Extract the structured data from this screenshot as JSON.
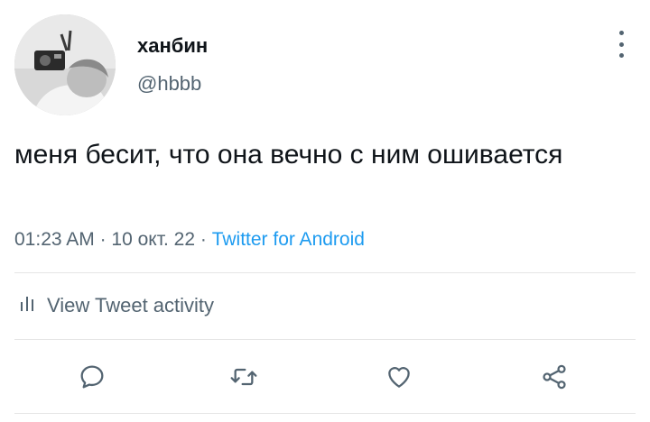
{
  "author": {
    "display_name": "ханбин",
    "handle": "@hbbb",
    "avatar_icon": "profile-photo"
  },
  "tweet": {
    "text": "меня бесит, что она вечно с ним ошивается",
    "time": "01:23 AM",
    "separator": " · ",
    "date": "10 окт. 22",
    "source": "Twitter for Android"
  },
  "activity": {
    "label": "View Tweet activity",
    "icon": "bar-chart-icon"
  },
  "actions": [
    "reply-icon",
    "retweet-icon",
    "like-icon",
    "share-icon"
  ],
  "colors": {
    "text": "#0f1419",
    "secondary": "#536471",
    "link": "#1d9bf0",
    "divider": "#e6e6e6"
  }
}
